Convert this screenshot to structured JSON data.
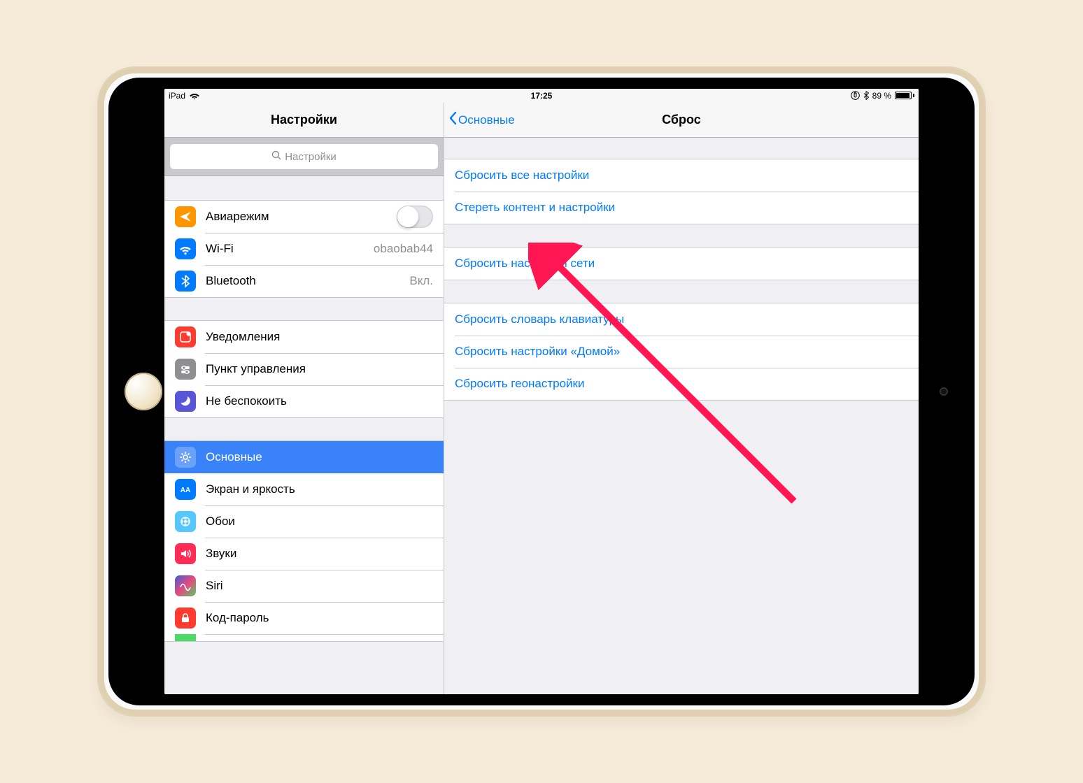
{
  "status": {
    "device": "iPad",
    "time": "17:25",
    "battery_text": "89 %"
  },
  "sidebar": {
    "title": "Настройки",
    "search_placeholder": "Настройки",
    "group1": {
      "airplane": "Авиарежим",
      "wifi_label": "Wi-Fi",
      "wifi_value": "obaobab44",
      "bluetooth_label": "Bluetooth",
      "bluetooth_value": "Вкл."
    },
    "group2": {
      "notifications": "Уведомления",
      "control_center": "Пункт управления",
      "dnd": "Не беспокоить"
    },
    "group3": {
      "general": "Основные",
      "display": "Экран и яркость",
      "wallpaper": "Обои",
      "sounds": "Звуки",
      "siri": "Siri",
      "passcode": "Код-пароль"
    }
  },
  "detail": {
    "back_label": "Основные",
    "title": "Сброс",
    "group1": {
      "reset_all": "Сбросить все настройки",
      "erase_all": "Стереть контент и настройки"
    },
    "group2": {
      "reset_network": "Сбросить настройки сети"
    },
    "group3": {
      "reset_keyboard": "Сбросить словарь клавиатуры",
      "reset_home": "Сбросить настройки «Домой»",
      "reset_location": "Сбросить геонастройки"
    }
  }
}
